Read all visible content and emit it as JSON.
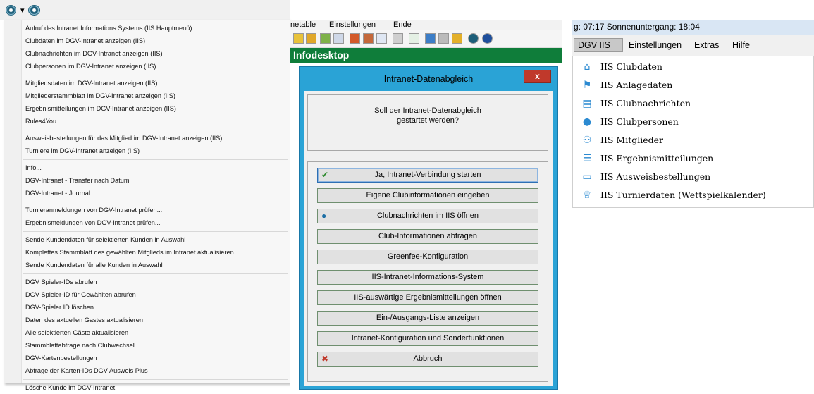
{
  "left_panel": {
    "toolbar": {
      "icon1": "iis-globe-icon",
      "dropdown": "▾",
      "icon2": "iis-globe-dropdown-icon"
    },
    "menu_groups": [
      [
        "Aufruf des Intranet Informations Systems (IIS Hauptmenü)",
        "Clubdaten im DGV-Intranet anzeigen (IIS)",
        "Clubnachrichten im DGV-Intranet anzeigen (IIS)",
        "Clubpersonen im DGV-Intranet anzeigen (IIS)"
      ],
      [
        "Mitgliedsdaten im DGV-Intranet anzeigen (IIS)",
        "Mitgliederstammblatt im DGV-Intranet anzeigen (IIS)",
        "Ergebnismitteilungen im DGV-Intranet anzeigen (IIS)",
        "Rules4You"
      ],
      [
        "Ausweisbestellungen für das Mitglied im DGV-Intranet anzeigen (IIS)",
        "Turniere im DGV-Intranet anzeigen (IIS)"
      ],
      [
        "Info...",
        "DGV-Intranet - Transfer nach Datum",
        "DGV-Intranet - Journal"
      ],
      [
        "Turnieranmeldungen von DGV-Intranet prüfen...",
        "Ergebnismeldungen von DGV-Intranet prüfen..."
      ],
      [
        "Sende Kundendaten für selektierten Kunden in Auswahl",
        "Komplettes Stammblatt des gewählten Mitglieds im Intranet aktualisieren",
        "Sende Kundendaten für alle Kunden in Auswahl"
      ],
      [
        "DGV Spieler-IDs abrufen",
        "DGV Spieler-ID für Gewählten abrufen",
        "DGV-Spieler ID löschen",
        "Daten des aktuellen Gastes aktualisieren",
        "Alle selektierten Gäste aktualisieren",
        "Stammblattabfrage nach Clubwechsel",
        "DGV-Kartenbestellungen",
        "Abfrage der Karten-IDs DGV Ausweis Plus"
      ],
      [
        "Lösche Kunde im DGV-Intranet"
      ]
    ]
  },
  "middle_panel": {
    "menubar": {
      "item1": "netable",
      "item2": "Einstellungen",
      "item3": "Ende"
    },
    "banner": "Infodesktop",
    "dialog": {
      "title": "Intranet-Datenabgleich",
      "close_label": "x",
      "question_line1": "Soll der Intranet-Datenabgleich",
      "question_line2": "gestartet werden?",
      "buttons": [
        {
          "label": "Ja, Intranet-Verbindung starten",
          "icon": "✔",
          "icon_name": "checkmark-icon",
          "icon_color": "#2e8b2e"
        },
        {
          "label": "Eigene Clubinformationen eingeben",
          "icon": "",
          "icon_name": "",
          "icon_color": ""
        },
        {
          "label": "Clubnachrichten im IIS öffnen",
          "icon": "●",
          "icon_name": "globe-icon",
          "icon_color": "#1d6fa5"
        },
        {
          "label": "Club-Informationen abfragen",
          "icon": "",
          "icon_name": "",
          "icon_color": ""
        },
        {
          "label": "Greenfee-Konfiguration",
          "icon": "",
          "icon_name": "",
          "icon_color": ""
        },
        {
          "label": "IIS-Intranet-Informations-System",
          "icon": "",
          "icon_name": "",
          "icon_color": ""
        },
        {
          "label": "IIS-auswärtige Ergebnismitteilungen öffnen",
          "icon": "",
          "icon_name": "",
          "icon_color": ""
        },
        {
          "label": "Ein-/Ausgangs-Liste anzeigen",
          "icon": "",
          "icon_name": "",
          "icon_color": ""
        },
        {
          "label": "Intranet-Konfiguration und Sonderfunktionen",
          "icon": "",
          "icon_name": "",
          "icon_color": ""
        },
        {
          "label": "Abbruch",
          "icon": "✖",
          "icon_name": "cancel-x-icon",
          "icon_color": "#c0392b"
        }
      ]
    }
  },
  "right_panel": {
    "status_text": "g: 07:17  Sonnenuntergang: 18:04",
    "menubar": {
      "item1": "DGV IIS",
      "item2": "Einstellungen",
      "item3": "Extras",
      "item4": "Hilfe"
    },
    "menu_items": [
      {
        "label": "IIS Clubdaten",
        "icon": "⌂",
        "icon_name": "home-icon"
      },
      {
        "label": "IIS Anlagedaten",
        "icon": "⚑",
        "icon_name": "flag-icon"
      },
      {
        "label": "IIS Clubnachrichten",
        "icon": "▤",
        "icon_name": "document-icon"
      },
      {
        "label": "IIS Clubpersonen",
        "icon": "●",
        "icon_name": "person-icon"
      },
      {
        "label": "IIS Mitglieder",
        "icon": "⚇",
        "icon_name": "users-icon"
      },
      {
        "label": "IIS Ergebnismitteilungen",
        "icon": "☰",
        "icon_name": "list-icon"
      },
      {
        "label": "IIS Ausweisbestellungen",
        "icon": "▭",
        "icon_name": "card-icon"
      },
      {
        "label": "IIS Turnierdaten (Wettspielkalender)",
        "icon": "♕",
        "icon_name": "trophy-icon"
      }
    ],
    "accent_color": "#2b8ad1"
  }
}
